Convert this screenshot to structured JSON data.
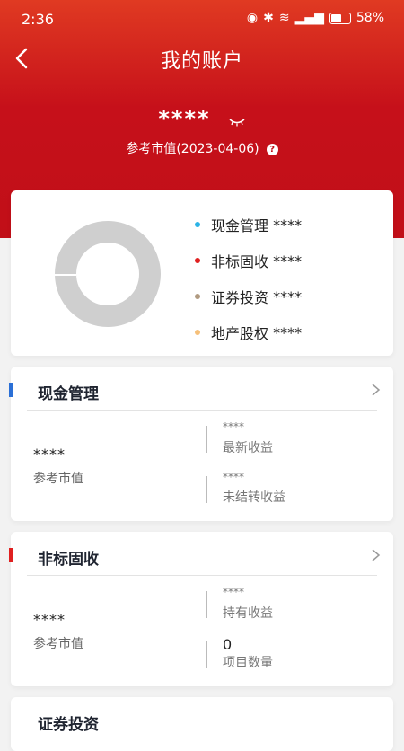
{
  "status": {
    "time": "2:36",
    "battery": "58%"
  },
  "nav": {
    "title": "我的账户"
  },
  "summary": {
    "total_value": "****",
    "ref_label": "参考市值(2023-04-06)",
    "help": "?"
  },
  "allocation": {
    "items": [
      {
        "label": "现金管理",
        "value": "****",
        "color": "#2bb3e6"
      },
      {
        "label": "非标固收",
        "value": "****",
        "color": "#e02020"
      },
      {
        "label": "证券投资",
        "value": "****",
        "color": "#b09a80"
      },
      {
        "label": "地产股权",
        "value": "****",
        "color": "#f6c07a"
      }
    ]
  },
  "sections": [
    {
      "title": "现金管理",
      "accent": "#2a6fd6",
      "market_value": "****",
      "market_label": "参考市值",
      "metric1_value": "****",
      "metric1_label": "最新收益",
      "metric2_value": "****",
      "metric2_label": "未结转收益"
    },
    {
      "title": "非标固收",
      "accent": "#e02020",
      "market_value": "****",
      "market_label": "参考市值",
      "metric1_value": "****",
      "metric1_label": "持有收益",
      "metric2_value": "0",
      "metric2_label": "项目数量"
    },
    {
      "title": "证券投资"
    }
  ]
}
